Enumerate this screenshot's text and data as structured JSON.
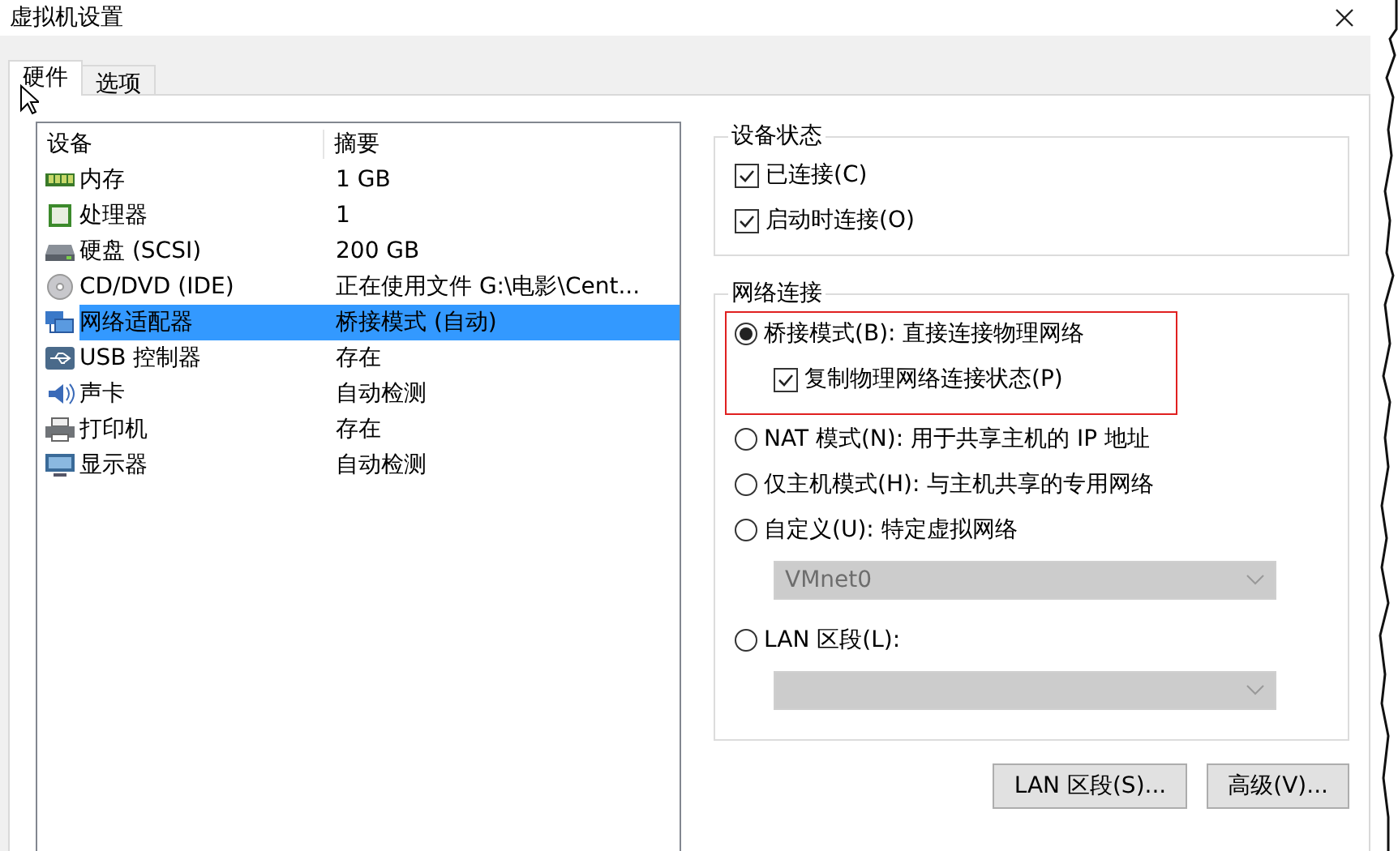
{
  "window": {
    "title": "虚拟机设置"
  },
  "tabs": [
    {
      "label": "硬件",
      "selected": true
    },
    {
      "label": "选项",
      "selected": false
    }
  ],
  "devices": {
    "columns": [
      "设备",
      "摘要"
    ],
    "rows": [
      {
        "kind": "memory",
        "name": "内存",
        "summary": "1 GB",
        "selected": false
      },
      {
        "kind": "cpu",
        "name": "处理器",
        "summary": "1",
        "selected": false
      },
      {
        "kind": "disk",
        "name": "硬盘 (SCSI)",
        "summary": "200 GB",
        "selected": false
      },
      {
        "kind": "cd",
        "name": "CD/DVD (IDE)",
        "summary": "正在使用文件 G:\\电影\\Cent...",
        "selected": false
      },
      {
        "kind": "network",
        "name": "网络适配器",
        "summary": "桥接模式 (自动)",
        "selected": true
      },
      {
        "kind": "usb",
        "name": "USB 控制器",
        "summary": "存在",
        "selected": false
      },
      {
        "kind": "sound",
        "name": "声卡",
        "summary": "自动检测",
        "selected": false
      },
      {
        "kind": "printer",
        "name": "打印机",
        "summary": "存在",
        "selected": false
      },
      {
        "kind": "display",
        "name": "显示器",
        "summary": "自动检测",
        "selected": false
      }
    ]
  },
  "device_status": {
    "title": "设备状态",
    "checkboxes": [
      {
        "label": "已连接(C)",
        "checked": true
      },
      {
        "label": "启动时连接(O)",
        "checked": true
      }
    ]
  },
  "network_connection": {
    "title": "网络连接",
    "options": [
      {
        "kind": "radio",
        "label": "桥接模式(B): 直接连接物理网络",
        "selected": true,
        "highlighted": true
      },
      {
        "kind": "checkbox",
        "label": "复制物理网络连接状态(P)",
        "checked": true,
        "highlighted": true
      },
      {
        "kind": "radio",
        "label": "NAT 模式(N): 用于共享主机的 IP 地址",
        "selected": false
      },
      {
        "kind": "radio",
        "label": "仅主机模式(H): 与主机共享的专用网络",
        "selected": false
      },
      {
        "kind": "radio",
        "label": "自定义(U): 特定虚拟网络",
        "selected": false
      },
      {
        "kind": "dropdown",
        "value": "VMnet0",
        "disabled": true
      },
      {
        "kind": "radio",
        "label": "LAN 区段(L):",
        "selected": false
      },
      {
        "kind": "dropdown",
        "disabled": true
      }
    ]
  },
  "buttons": [
    "LAN 区段(S)...",
    "高级(V)..."
  ]
}
